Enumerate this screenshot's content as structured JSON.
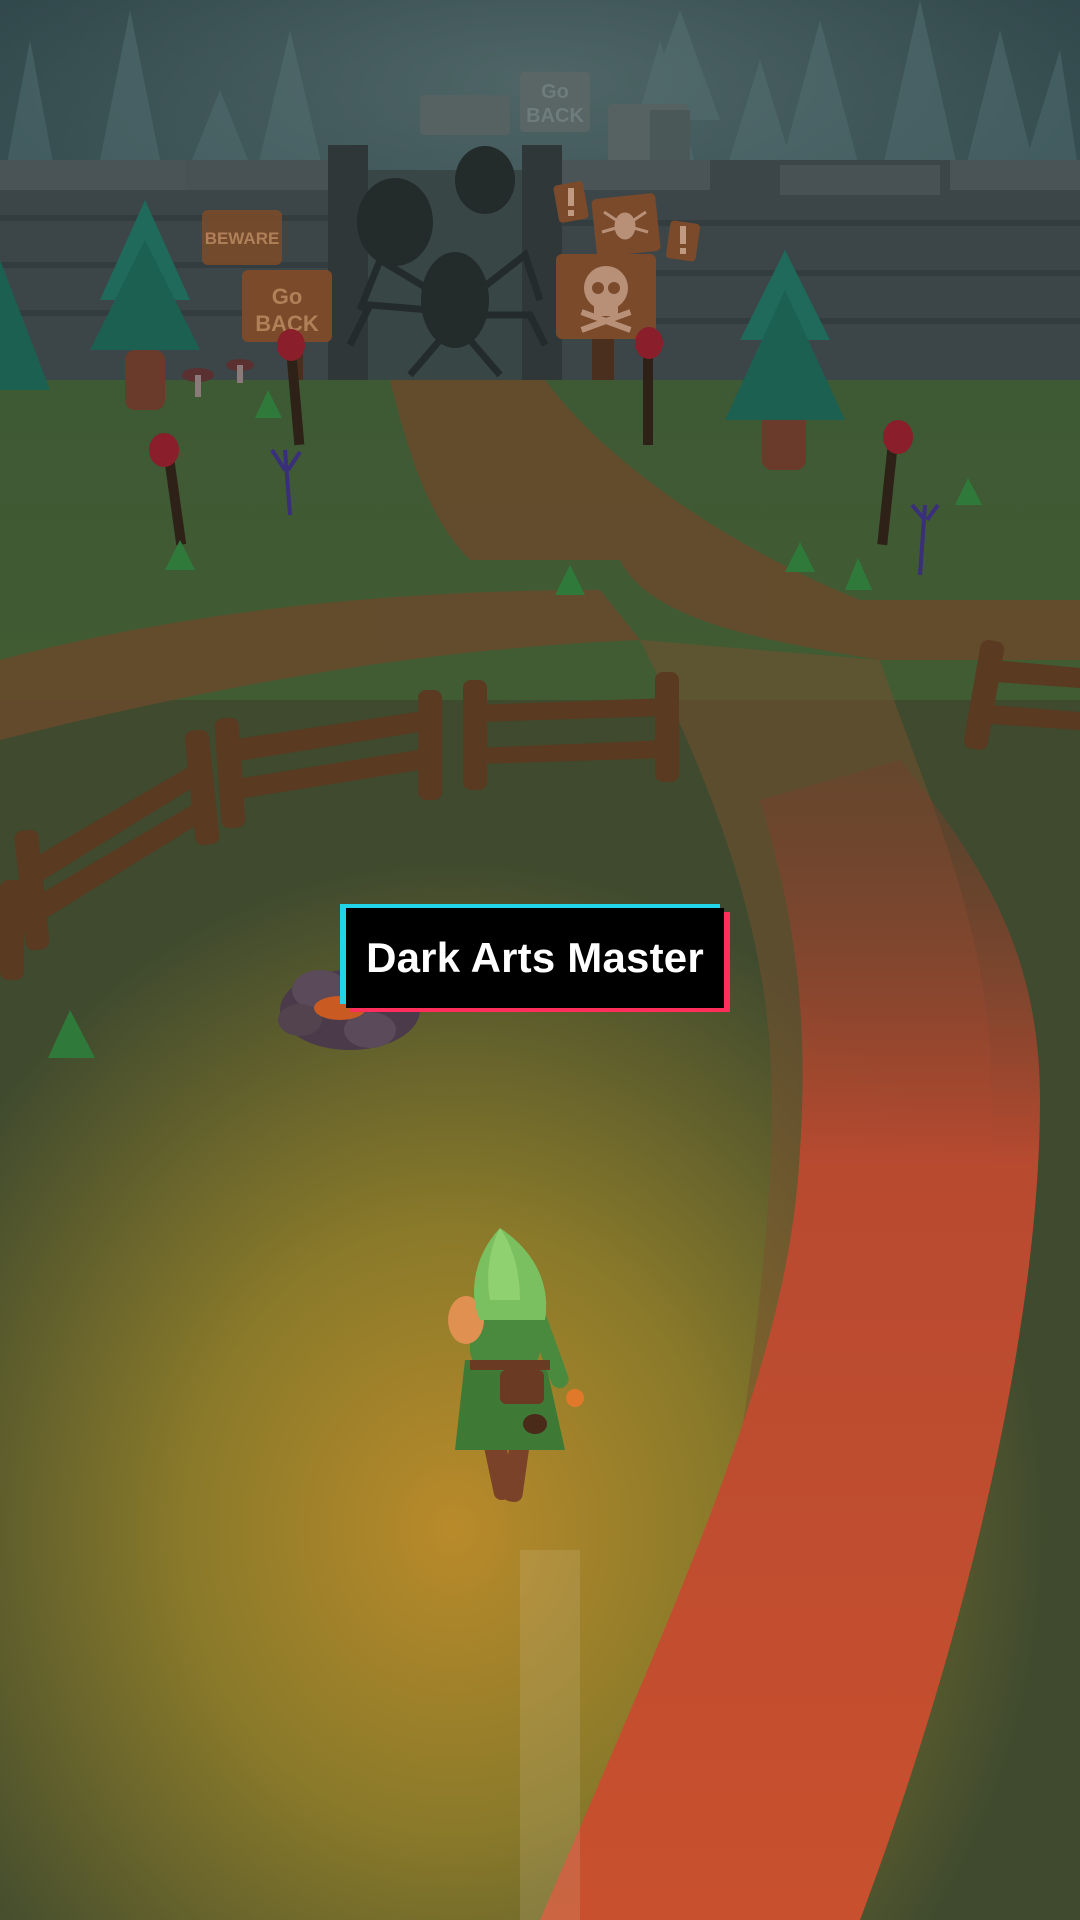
{
  "scene": {
    "signs": {
      "beware": "BEWARE",
      "go_back_near_go": "Go",
      "go_back_near_back": "BACK",
      "go_back_far_go": "Go",
      "go_back_far_back": "BACK"
    },
    "icons": [
      "spider-icon",
      "skull-icon",
      "warning-icon"
    ]
  },
  "caption": {
    "text": "Dark Arts Master"
  }
}
